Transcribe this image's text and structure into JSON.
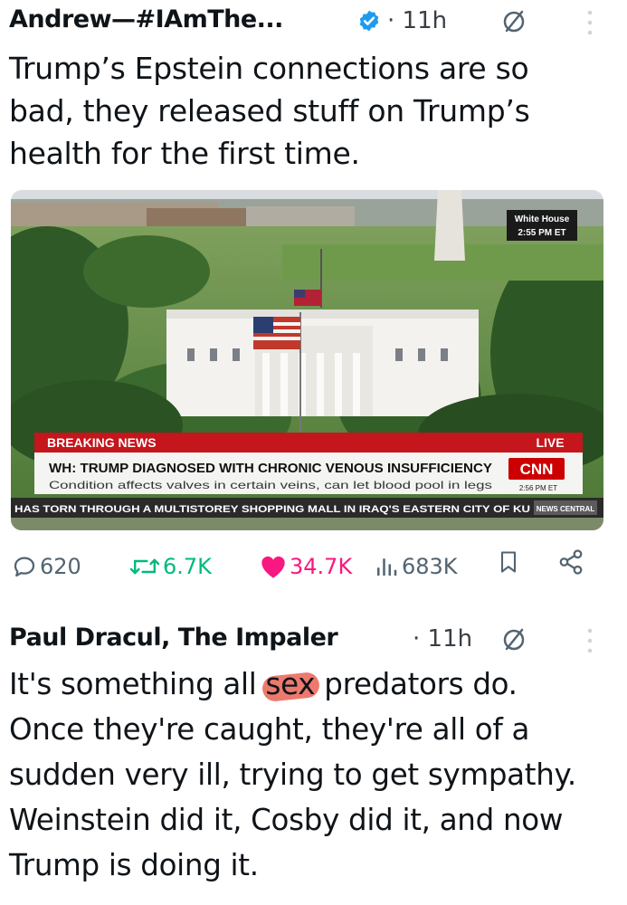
{
  "post1": {
    "author": "Andrew—#IAmThe...",
    "time": "· 11h",
    "text_lines": [
      "Trump’s Epstein connections are so",
      "bad, they released stuff on Trump’s",
      "health for the first time."
    ],
    "media": {
      "location_tag": "White House",
      "location_time": "2:55 PM ET",
      "breaking_label": "BREAKING NEWS",
      "live_label": "LIVE",
      "headline": "WH: TRUMP DIAGNOSED WITH CHRONIC VENOUS INSUFFICIENCY",
      "subheadline": "Condition affects valves in certain veins, can let blood pool in legs",
      "network": "CNN",
      "network_time": "2:56 PM ET",
      "ticker": "HAS TORN THROUGH A MULTISTOREY SHOPPING MALL IN IRAQ'S EASTERN CITY OF KU",
      "ticker_tag": "NEWS CENTRAL"
    },
    "actions": {
      "replies": "620",
      "reposts": "6.7K",
      "likes": "34.7K",
      "views": "683K"
    }
  },
  "post2": {
    "author": "Paul Dracul, The Impaler",
    "time": "· 11h",
    "text_before": "It's something all ",
    "text_highlight": "sex",
    "text_after": " predators do.",
    "text_lines": [
      "Once they're caught, they're all of a",
      "sudden very ill, trying to get sympathy.",
      "Weinstein did it, Cosby did it, and now",
      "Trump is doing it."
    ]
  },
  "colors": {
    "verified": "#1d9bf0",
    "like": "#f91880",
    "repost": "#00ba7c",
    "muted": "#536471",
    "breaking_red": "#c4161c"
  }
}
